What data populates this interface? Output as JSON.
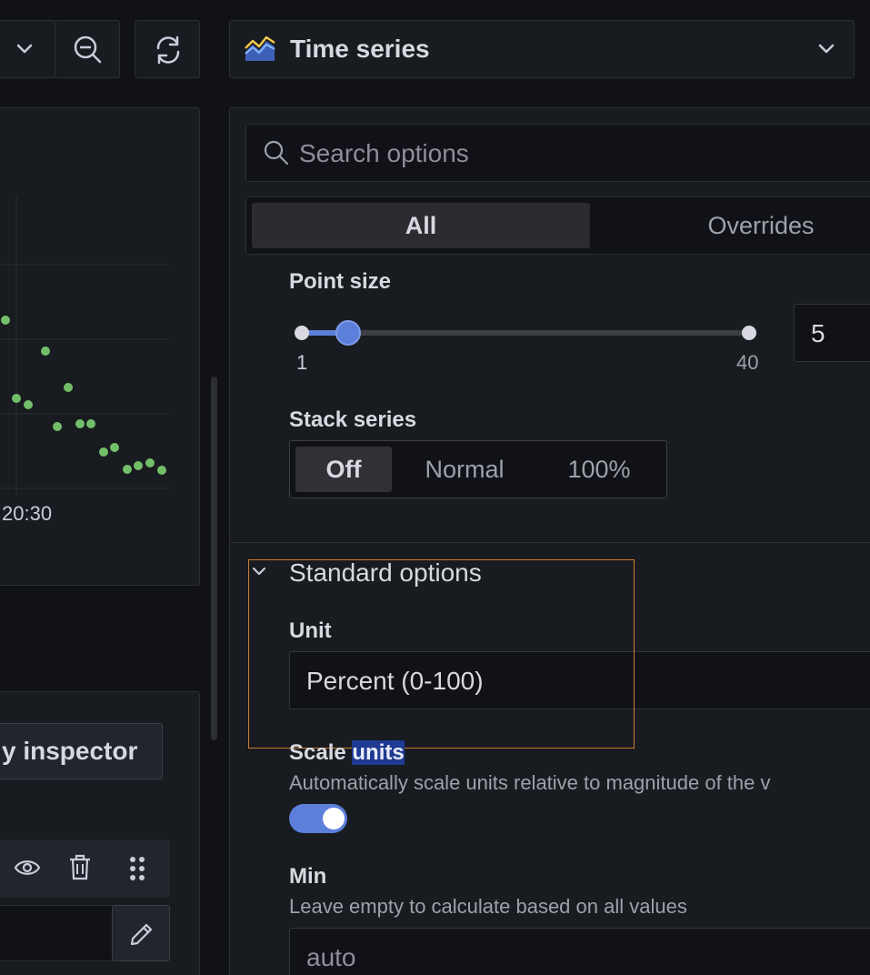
{
  "toolbar": {
    "visualization": "Time series"
  },
  "graph": {
    "x_tick": "20:30"
  },
  "left_bottom": {
    "inspector_button": "y inspector"
  },
  "options": {
    "search_placeholder": "Search options",
    "tabs": {
      "all": "All",
      "overrides": "Overrides"
    },
    "point_size": {
      "label": "Point size",
      "min": "1",
      "max": "40",
      "value": "5",
      "slider_fraction": 0.103
    },
    "stack_series": {
      "label": "Stack series",
      "options": [
        "Off",
        "Normal",
        "100%"
      ],
      "selected": "Off"
    },
    "standard_options": {
      "section_title": "Standard options",
      "unit_label": "Unit",
      "unit_value": "Percent (0-100)",
      "scale_label_prefix": "Scale ",
      "scale_label_highlight": "units",
      "scale_desc": "Automatically scale units relative to magnitude of the v",
      "scale_enabled": true,
      "min_label": "Min",
      "min_desc": "Leave empty to calculate based on all values",
      "min_placeholder": "auto"
    }
  },
  "colors": {
    "accent": "#5b7fdb",
    "series": "#73bf69",
    "highlight_box": "#cf7c39",
    "text_highlight_bg": "#1f3a93"
  }
}
